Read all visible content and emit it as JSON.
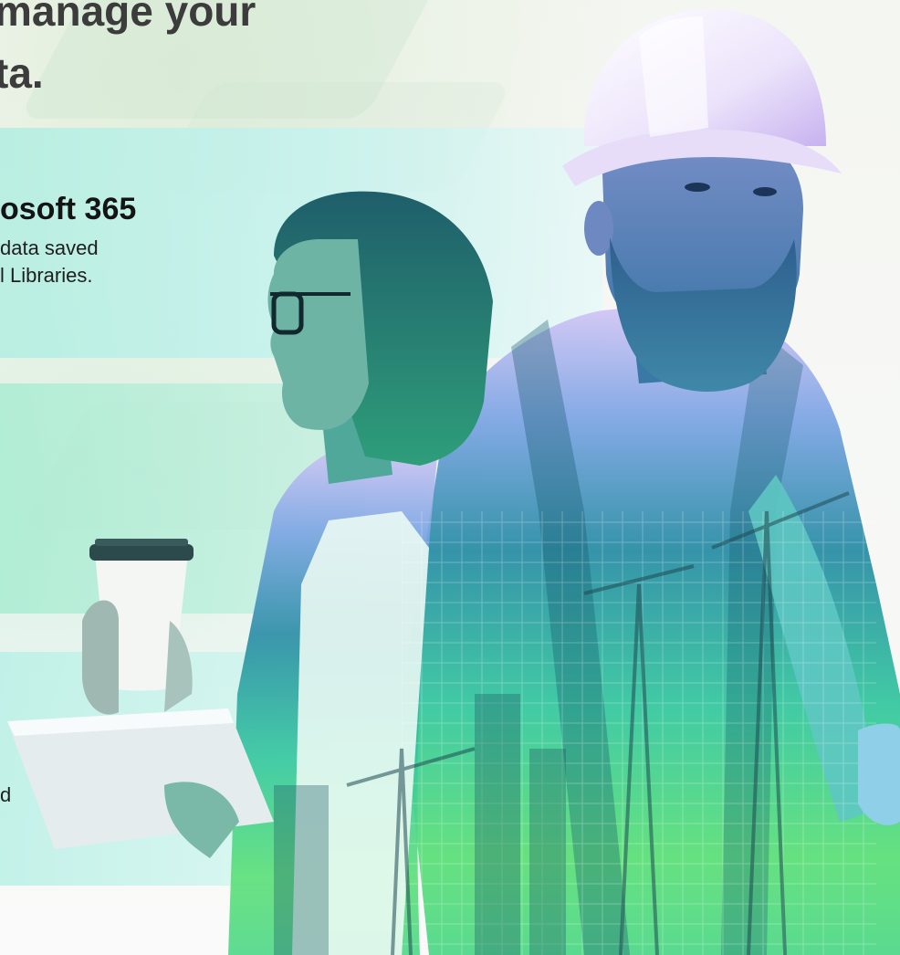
{
  "hero": {
    "headline": "manage your\nta."
  },
  "card1": {
    "title": "osoft 365",
    "body": "data saved\nl Libraries."
  },
  "card3": {
    "text": "d"
  },
  "colors": {
    "headline": "#3c3c3c",
    "band": "#c4f2ee",
    "gradient_top": "#c9b8f0",
    "gradient_mid": "#5fc7c9",
    "gradient_bottom": "#5fe07a"
  },
  "images": {
    "photo_subject": "photo of a woman with glasses holding a coffee cup and tablet, and a bearded man in a hard hat, overlaid with cranes and a city skyline"
  }
}
